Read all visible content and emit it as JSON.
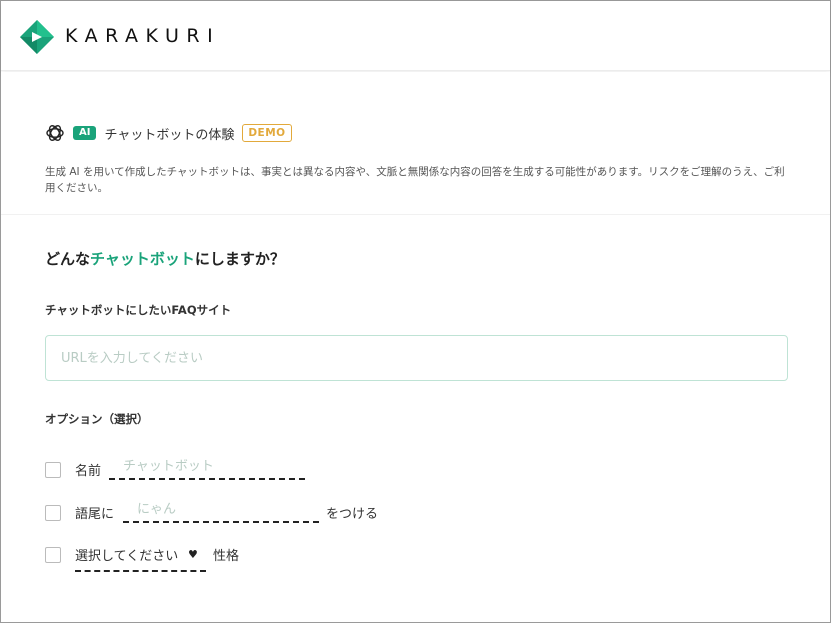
{
  "header": {
    "logo_text": "KARAKURI"
  },
  "banner": {
    "ai_badge": "AI",
    "title": "チャットボットの体験",
    "demo_badge": "DEMO",
    "disclaimer": "生成 AI を用いて作成したチャットボットは、事実とは異なる内容や、文脈と無関係な内容の回答を生成する可能性があります。リスクをご理解のうえ、ご利用ください。"
  },
  "form": {
    "heading_prefix": "どんな",
    "heading_accent": "チャットボット",
    "heading_suffix": "にしますか？",
    "faq_label": "チャットボットにしたいFAQサイト",
    "url_placeholder": "URLを入力してください",
    "options_label": "オプション（選択）",
    "options": {
      "name_label": "名前",
      "name_placeholder": "チャットボット",
      "suffix_label": "語尾に",
      "suffix_placeholder": "にゃん",
      "suffix_after": "をつける",
      "personality_select": "選択してください",
      "personality_label": "性格"
    }
  },
  "colors": {
    "brand_green": "#1aa37a",
    "demo_orange": "#e2a93b"
  },
  "icons": {
    "logo": "karakuri-logo-icon",
    "openai": "openai-icon",
    "select_arrow": "heart-icon"
  }
}
